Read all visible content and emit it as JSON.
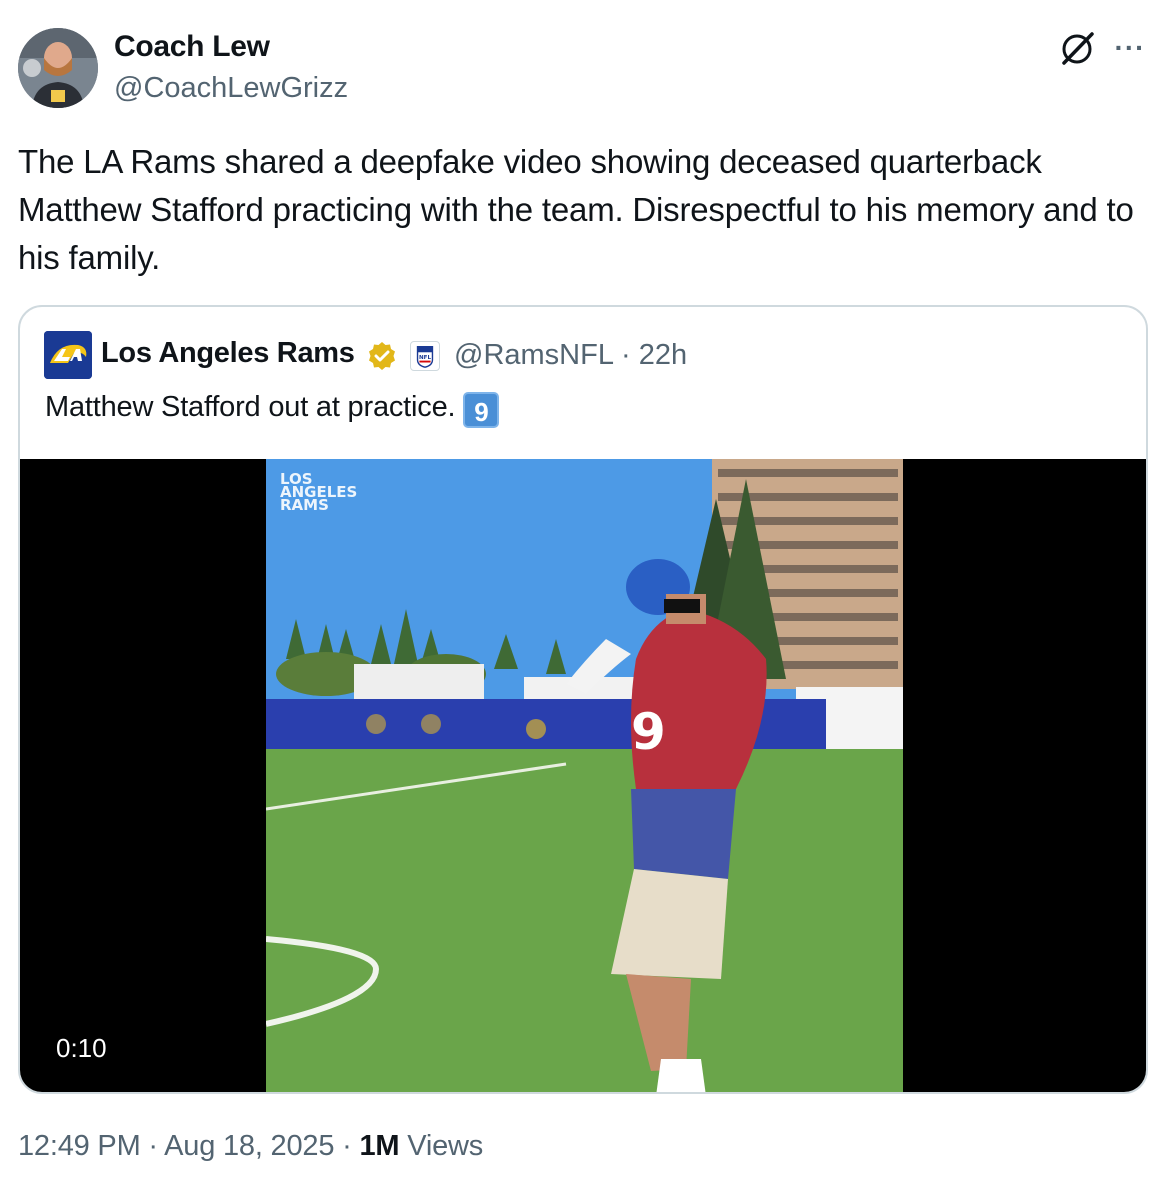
{
  "author": {
    "name": "Coach Lew",
    "handle": "@CoachLewGrizz"
  },
  "tweet": {
    "text": "The LA Rams shared a deepfake video showing deceased quarterback Matthew Stafford practicing with the team. Disrespectful to his memory and to his family."
  },
  "quoted": {
    "name": "Los Angeles Rams",
    "handle": "@RamsNFL",
    "separator": "·",
    "age": "22h",
    "text": "Matthew Stafford out at practice.",
    "keycap": "9",
    "video": {
      "duration": "0:10",
      "watermark": [
        "LOS",
        "ANGELES",
        "RAMS"
      ]
    }
  },
  "footer": {
    "time": "12:49 PM",
    "sep1": "·",
    "date": "Aug 18, 2025",
    "sep2": "·",
    "views_count": "1M",
    "views_label": "Views"
  },
  "icons": {
    "grok": "grok-icon",
    "more": "more-icon",
    "verified": "verified-badge-icon",
    "affiliate": "nfl-affiliate-icon"
  },
  "colors": {
    "text": "#0f1419",
    "secondary": "#536471",
    "border": "#cfd9de",
    "rams_blue": "#1a3a94",
    "verified_gold": "#e2b719"
  }
}
